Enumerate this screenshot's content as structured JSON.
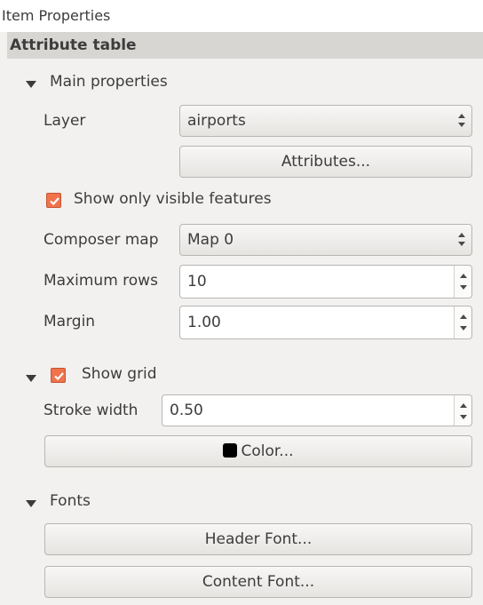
{
  "window": {
    "title": "Item Properties"
  },
  "section": {
    "title": "Attribute table"
  },
  "main_properties": {
    "label": "Main properties",
    "layer_label": "Layer",
    "layer_value": "airports",
    "attributes_button": "Attributes...",
    "show_visible_label": "Show only visible features",
    "show_visible_checked": true,
    "composer_map_label": "Composer map",
    "composer_map_value": "Map 0",
    "max_rows_label": "Maximum rows",
    "max_rows_value": "10",
    "margin_label": "Margin",
    "margin_value": "1.00"
  },
  "grid": {
    "label": "Show grid",
    "checked": true,
    "stroke_width_label": "Stroke width",
    "stroke_width_value": "0.50",
    "color_button": "Color...",
    "color_swatch": "#000000"
  },
  "fonts": {
    "label": "Fonts",
    "header_font_button": "Header Font...",
    "content_font_button": "Content Font..."
  },
  "colors": {
    "checkbox_accent": "#f0734c",
    "header_bg": "#d8d6d3"
  }
}
